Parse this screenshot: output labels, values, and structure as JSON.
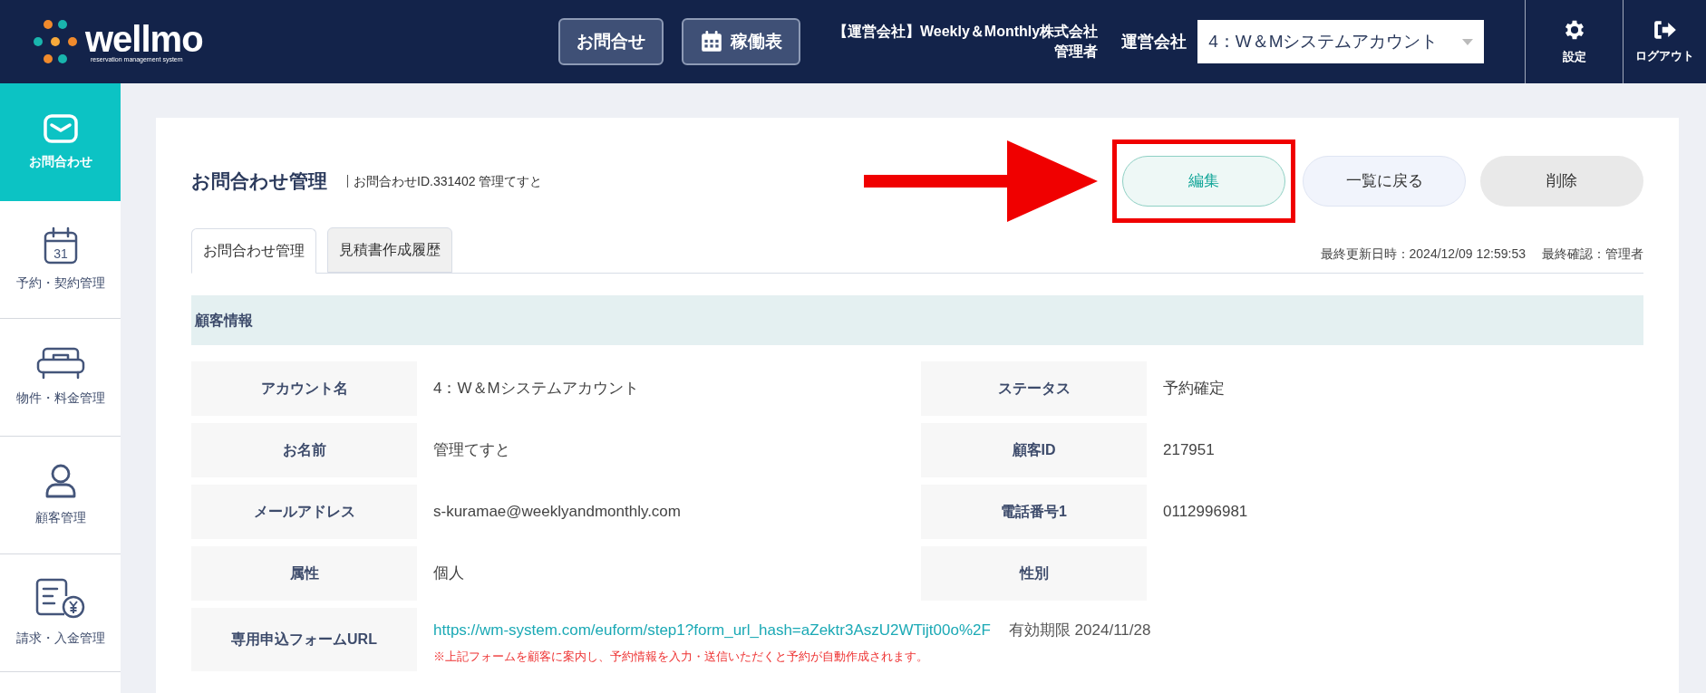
{
  "header": {
    "logo": {
      "name": "wellmo",
      "tagline": "reservation management system"
    },
    "buttons": [
      {
        "label": "お問合せ"
      },
      {
        "label": "稼働表"
      }
    ],
    "company": "【運営会社】Weekly＆Monthly株式会社",
    "role": "管理者",
    "operator_label": "運営会社",
    "operator_select": "4：W＆Mシステムアカウント",
    "actions": [
      {
        "label": "設定"
      },
      {
        "label": "ログアウト"
      }
    ]
  },
  "sidebar": {
    "items": [
      {
        "label": "お問合わせ",
        "selected": true
      },
      {
        "label": "予約・契約管理",
        "icon_text": "31",
        "selected": false
      },
      {
        "label": "物件・料金管理",
        "selected": false
      },
      {
        "label": "顧客管理",
        "selected": false
      },
      {
        "label": "請求・入金管理",
        "selected": false
      }
    ]
  },
  "page": {
    "title": "お問合わせ管理",
    "subtitle": "お問合わせID.331402 管理てすと",
    "actions": [
      {
        "label": "編集",
        "kind": "primary",
        "highlighted": true
      },
      {
        "label": "一覧に戻る",
        "kind": "secondary",
        "highlighted": false
      },
      {
        "label": "削除",
        "kind": "danger",
        "highlighted": false
      }
    ],
    "tabs": [
      {
        "label": "お問合わせ管理",
        "selected": true
      },
      {
        "label": "見積書作成履歴",
        "selected": false
      }
    ],
    "last_updated": "最終更新日時：2024/12/09 12:59:53",
    "last_confirmed": "最終確認：管理者",
    "section": {
      "title": "顧客情報",
      "rows": [
        [
          {
            "label": "アカウント名",
            "value": "4：W＆Mシステムアカウント"
          },
          {
            "label": "ステータス",
            "value": "予約確定"
          }
        ],
        [
          {
            "label": "お名前",
            "value": "管理てすと"
          },
          {
            "label": "顧客ID",
            "value": "217951"
          }
        ],
        [
          {
            "label": "メールアドレス",
            "value": "s-kuramae@weeklyandmonthly.com"
          },
          {
            "label": "電話番号1",
            "value": "0112996981"
          }
        ],
        [
          {
            "label": "属性",
            "value": "個人"
          },
          {
            "label": "性別"
          }
        ]
      ],
      "form_url": {
        "label": "専用申込フォームURL",
        "url": "https://wm-system.com/euform/step1?form_url_hash=aZektr3AszU2WTijt00o%2F",
        "expiry": "有効期限 2024/11/28",
        "note": "※上記フォームを顧客に案内し、予約情報を入力・送信いただくと予約が自動作成されます。"
      }
    }
  }
}
